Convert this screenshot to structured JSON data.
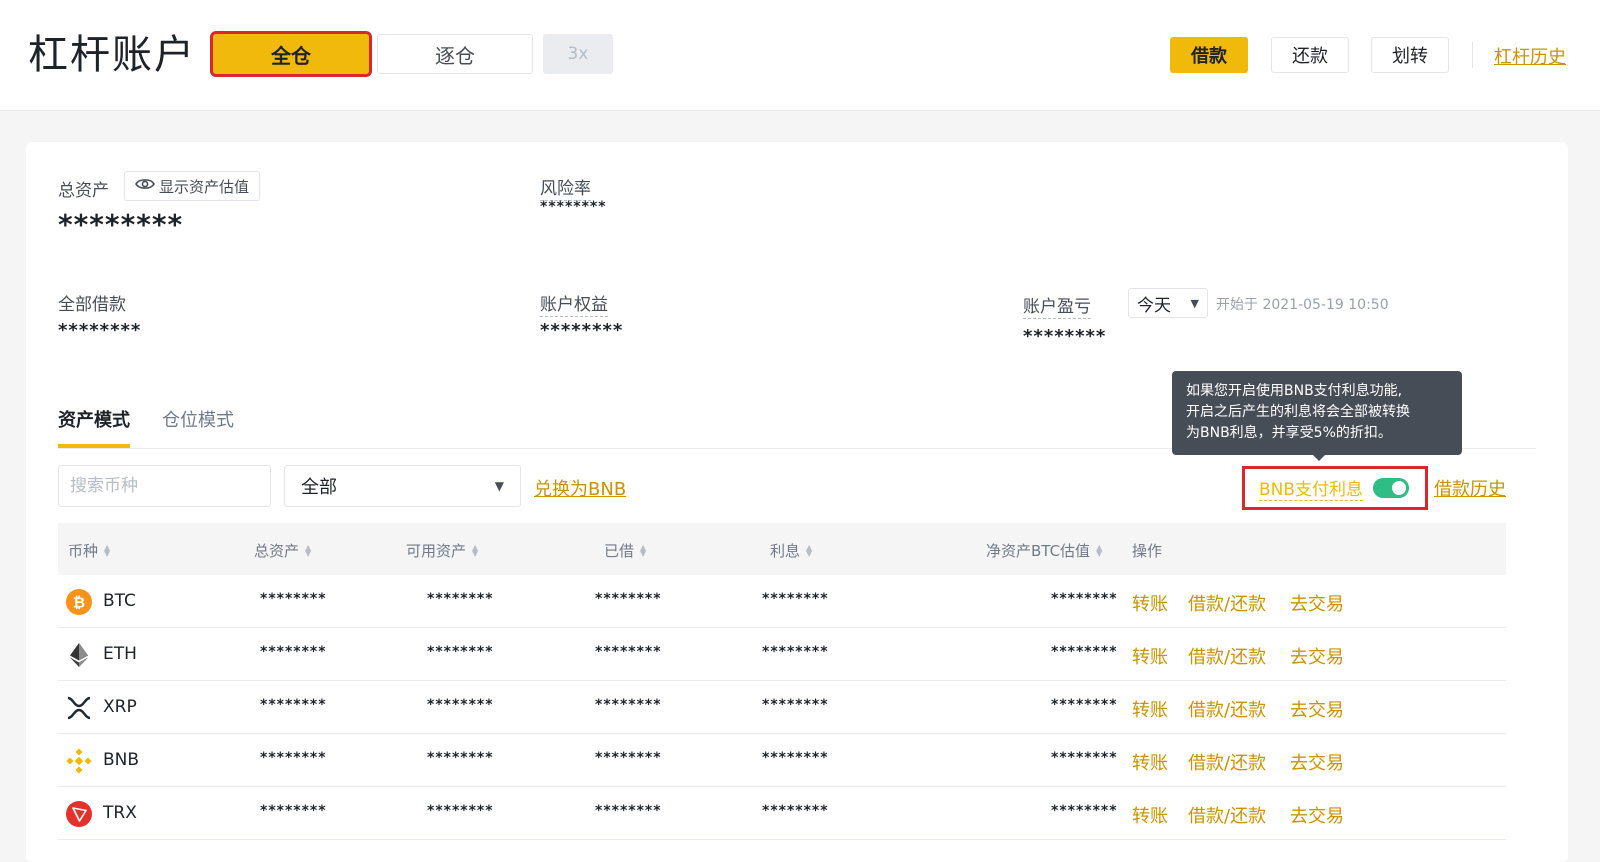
{
  "header": {
    "title": "杠杆账户",
    "modes": {
      "cross": "全仓",
      "isolated": "逐仓",
      "leverage": "3x"
    },
    "buttons": {
      "borrow": "借款",
      "repay": "还款",
      "transfer": "划转"
    },
    "history_link": "杠杆历史"
  },
  "summary": {
    "total_assets_label": "总资产",
    "show_estimate_label": "显示资产估值",
    "total_assets_value": "********",
    "risk_rate_label": "风险率",
    "risk_rate_value": "********",
    "total_borrowed_label": "全部借款",
    "total_borrowed_value": "********",
    "equity_label": "账户权益",
    "equity_value": "********",
    "pnl_label": "账户盈亏",
    "pnl_range": "今天",
    "pnl_start": "开始于 2021-05-19 10:50",
    "pnl_value": "********"
  },
  "tabs": {
    "asset_mode": "资产模式",
    "position_mode": "仓位模式"
  },
  "toolbar": {
    "search_placeholder": "搜索币种",
    "filter_value": "全部",
    "convert_link": "兑换为BNB",
    "bnb_interest_label": "BNB支付利息",
    "bnb_interest_enabled": true,
    "borrow_history": "借款历史"
  },
  "tooltip": {
    "line1": "如果您开启使用BNB支付利息功能,",
    "line2": "开启之后产生的利息将会全部被转换",
    "line3": "为BNB利息，并享受5%的折扣。"
  },
  "table": {
    "headers": {
      "coin": "币种",
      "total": "总资产",
      "available": "可用资产",
      "borrowed": "已借",
      "interest": "利息",
      "net_btc": "净资产BTC估值",
      "action": "操作"
    },
    "actions": {
      "transfer": "转账",
      "borrow_repay": "借款/还款",
      "trade": "去交易"
    },
    "rows": [
      {
        "coin": "BTC",
        "total": "********",
        "available": "********",
        "borrowed": "********",
        "interest": "********",
        "net_btc": "********"
      },
      {
        "coin": "ETH",
        "total": "********",
        "available": "********",
        "borrowed": "********",
        "interest": "********",
        "net_btc": "********"
      },
      {
        "coin": "XRP",
        "total": "********",
        "available": "********",
        "borrowed": "********",
        "interest": "********",
        "net_btc": "********"
      },
      {
        "coin": "BNB",
        "total": "********",
        "available": "********",
        "borrowed": "********",
        "interest": "********",
        "net_btc": "********"
      },
      {
        "coin": "TRX",
        "total": "********",
        "available": "********",
        "borrowed": "********",
        "interest": "********",
        "net_btc": "********"
      }
    ]
  },
  "colors": {
    "accent": "#f0b90b",
    "link": "#c99400",
    "highlight_border": "#d9272e",
    "toggle_on": "#2ebd85"
  }
}
